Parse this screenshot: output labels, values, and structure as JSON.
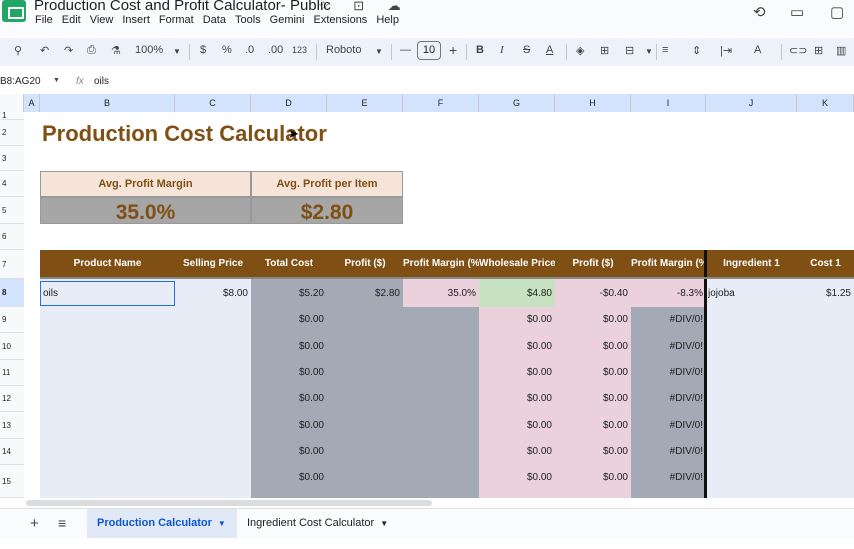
{
  "window": {
    "doc_title": "Production Cost and Profit Calculator- Public",
    "title_icons": "☆ ⊡ ☁"
  },
  "menu": [
    "File",
    "Edit",
    "View",
    "Insert",
    "Format",
    "Data",
    "Tools",
    "Gemini",
    "Extensions",
    "Help"
  ],
  "right_icons": {
    "history": "⟲",
    "comments": "▭",
    "meet": "▢"
  },
  "toolbar": {
    "search": "⚲",
    "undo": "↶",
    "redo": "↷",
    "print": "⎙",
    "paint_format": "⚗",
    "zoom": "100%",
    "currency": "$",
    "percent": "%",
    "dec_less": ".0",
    "dec_more": ".00",
    "format_123": "123",
    "font": "Roboto",
    "minus": "—",
    "font_size": "10",
    "plus": "+",
    "bold": "B",
    "italic": "I",
    "strike": "S",
    "text_color": "A",
    "fill": "◈",
    "borders": "⊞",
    "merge": "⊟",
    "align": "≡",
    "valign": "⇕",
    "wrap": "|⇥",
    "rotate": "A",
    "link": "⊂⊃",
    "comment": "⊞",
    "chart": "▥"
  },
  "formula_bar": {
    "name_box": "B8:AG20",
    "fx": "fx",
    "content": "oils"
  },
  "columns": [
    "A",
    "B",
    "C",
    "D",
    "E",
    "F",
    "G",
    "H",
    "I",
    "J",
    "K"
  ],
  "rows": [
    "1",
    "2",
    "3",
    "4",
    "5",
    "6",
    "7",
    "8",
    "9",
    "10",
    "11",
    "12",
    "13",
    "14",
    "15"
  ],
  "sheet": {
    "title": "Production Cost Calculator",
    "stats": {
      "margin_label": "Avg. Profit Margin",
      "margin_value": "35.0%",
      "profit_label": "Avg. Profit per Item",
      "profit_value": "$2.80"
    },
    "headers": [
      "Product Name",
      "Selling Price",
      "Total Cost",
      "Profit ($)",
      "Profit Margin (%)",
      "Wholesale Price",
      "Profit ($)",
      "Profit Margin (%)",
      "Ingredient 1",
      "Cost 1"
    ],
    "first_row": [
      "oils",
      "$8.00",
      "$5.20",
      "$2.80",
      "35.0%",
      "$4.80",
      "-$0.40",
      "-8.3%",
      "jojoba",
      "$1.25"
    ],
    "empty_total_cost": "$0.00",
    "empty_wholesale": "$0.00",
    "empty_profit": "$0.00",
    "empty_margin": "#DIV/0!",
    "empty_row_count": 7
  },
  "tabs": {
    "add": "+",
    "list": "≡",
    "active": "Production Calculator",
    "other": "Ingredient Cost Calculator"
  },
  "colors": {
    "header_brown": "#7f4f14",
    "accent_blue": "#0b57d0",
    "sheets_green": "#23a566"
  }
}
